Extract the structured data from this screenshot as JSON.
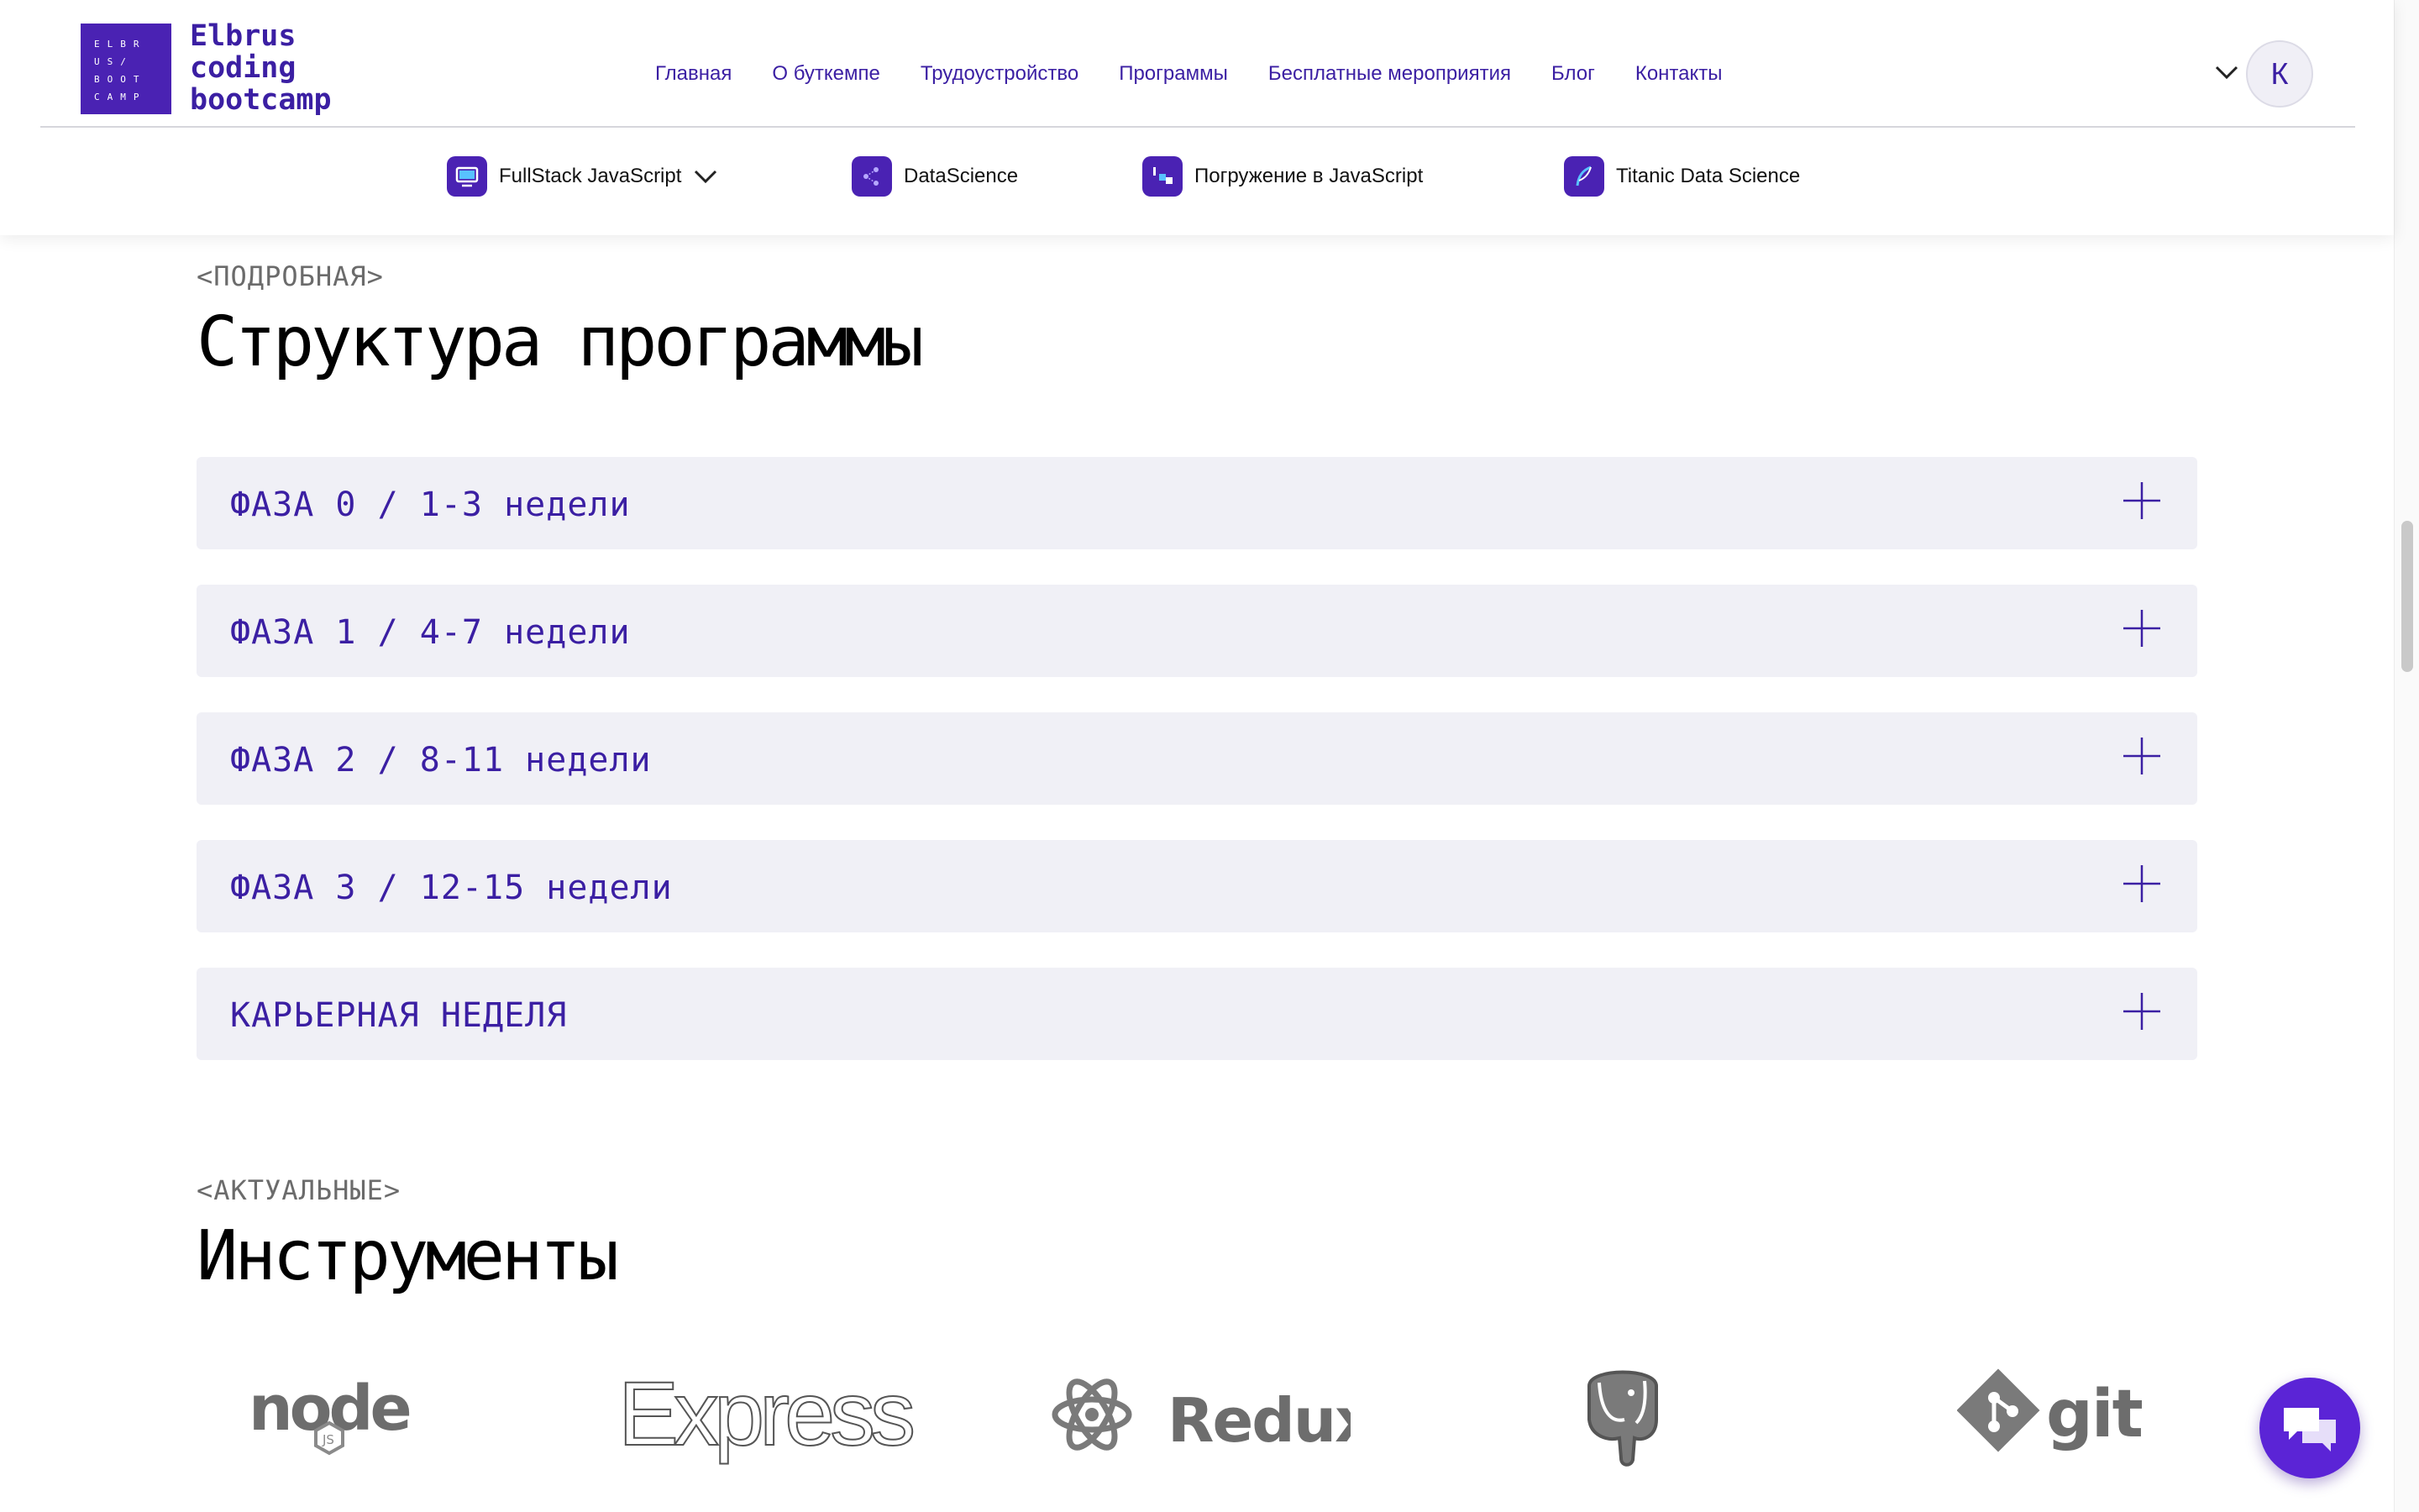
{
  "logo": {
    "grid_lines": [
      "ELBR",
      "US/",
      "BOOT",
      "CAMP"
    ],
    "text_lines": [
      "Elbrus",
      "coding",
      "bootcamp"
    ],
    "color": "#4a22b3"
  },
  "nav": {
    "items": [
      "Главная",
      "О буткемпе",
      "Трудоустройство",
      "Программы",
      "Бесплатные мероприятия",
      "Блог",
      "Контакты"
    ],
    "avatar_letter": "К"
  },
  "programs": [
    {
      "label": "FullStack JavaScript",
      "icon": "monitor-icon",
      "has_dropdown": true
    },
    {
      "label": "DataScience",
      "icon": "graph-nodes-icon",
      "has_dropdown": false
    },
    {
      "label": "Погружение в JavaScript",
      "icon": "blocks-icon",
      "has_dropdown": false
    },
    {
      "label": "Titanic Data Science",
      "icon": "feather-icon",
      "has_dropdown": false
    }
  ],
  "structure": {
    "eyebrow": "<ПОДРОБНАЯ>",
    "title": "Структура программы",
    "phases": [
      "ФАЗА 0 / 1-3 недели",
      "ФАЗА 1 / 4-7 недели",
      "ФАЗА 2 / 8-11 недели",
      "ФАЗА 3 / 12-15 недели",
      "КАРЬЕРНАЯ НЕДЕЛЯ"
    ]
  },
  "tools": {
    "eyebrow": "<АКТУАЛЬНЫЕ>",
    "title": "Инструменты",
    "items": [
      "node",
      "Express",
      "Redux",
      "PostgreSQL",
      "git"
    ],
    "node_sub": "JS"
  },
  "colors": {
    "accent": "#3b1fa3",
    "accordion_bg": "#f0f0f6",
    "chat_button": "#5b24d6"
  }
}
